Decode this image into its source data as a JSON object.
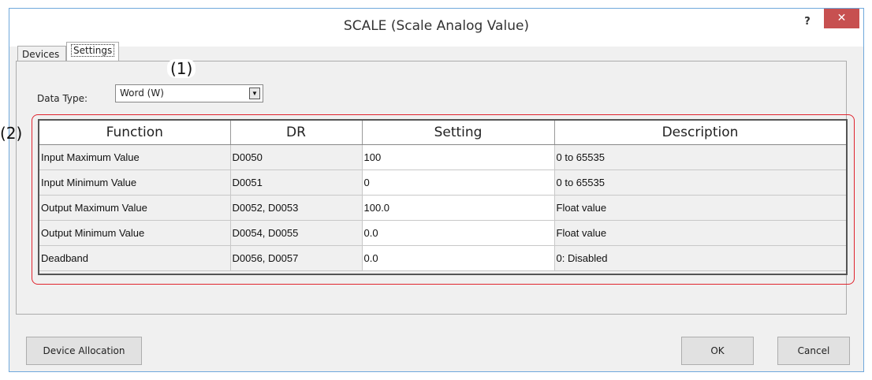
{
  "window": {
    "title": "SCALE (Scale Analog Value)",
    "help_label": "?",
    "close_label": "✕"
  },
  "tabs": [
    {
      "label": "Devices"
    },
    {
      "label": "Settings"
    }
  ],
  "callouts": {
    "one": "(1)",
    "two": "(2)"
  },
  "data_type": {
    "label": "Data Type:",
    "value": "Word (W)",
    "arrow": "▼"
  },
  "table": {
    "headers": [
      "Function",
      "DR",
      "Setting",
      "Description"
    ],
    "rows": [
      [
        "Input Maximum Value",
        "D0050",
        "100",
        "0 to 65535"
      ],
      [
        "Input Minimum Value",
        "D0051",
        "0",
        "0 to 65535"
      ],
      [
        "Output Maximum Value",
        "D0052, D0053",
        "100.0",
        "Float value"
      ],
      [
        "Output Minimum Value",
        "D0054, D0055",
        "0.0",
        "Float value"
      ],
      [
        "Deadband",
        "D0056, D0057",
        "0.0",
        "0: Disabled"
      ]
    ]
  },
  "buttons": {
    "device_allocation": "Device Allocation",
    "ok": "OK",
    "cancel": "Cancel"
  },
  "colors": {
    "close_button": "#c75050",
    "highlight_border": "#e0242e",
    "window_border": "#6fa8dc"
  }
}
